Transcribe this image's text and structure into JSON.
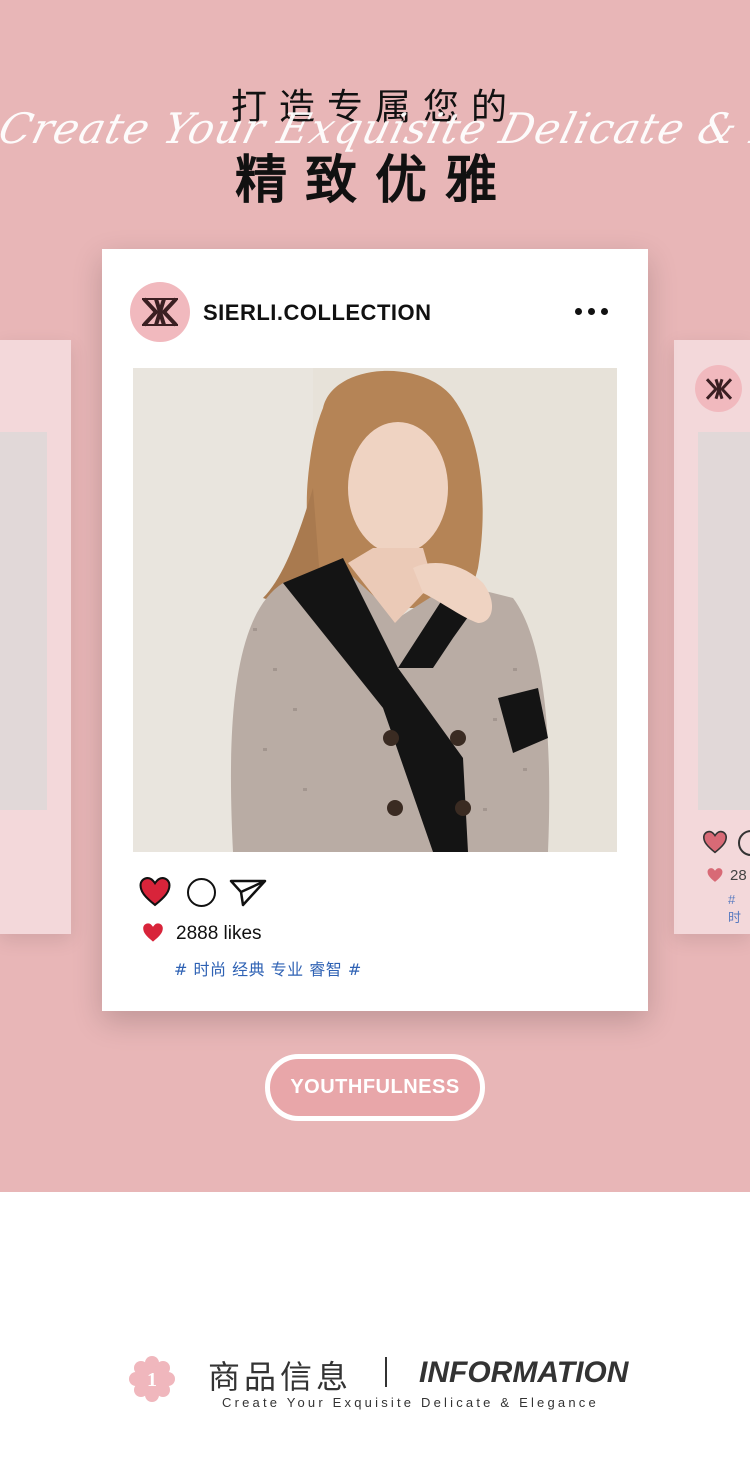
{
  "hero": {
    "headline_line1": "打造专属您的",
    "script_text": "Create Your Exquisite Delicate & Elegance",
    "headline_line2": "精致优雅"
  },
  "post": {
    "account_name": "SIERLI.COLLECTION",
    "more_icon": "ellipsis-icon",
    "photo_subject": "model-in-tweed-blazer-photo",
    "likes_text": "2888 likes",
    "tags_text": "# 时尚 经典 专业 睿智 #"
  },
  "side_posts": {
    "likes_partial": "28",
    "tags_partial": "# 时"
  },
  "tag_pill": {
    "label": "YOUTHFULNESS"
  },
  "info_header": {
    "badge_number": "1",
    "title_cn": "商品信息",
    "title_en": "INFORMATION",
    "subtitle": "Create Your Exquisite Delicate & Elegance"
  },
  "colors": {
    "background_pink": "#e8b6b7",
    "heart_red": "#d8243a",
    "tag_blue": "#2f62b4",
    "badge_pink": "#f1b9be"
  }
}
